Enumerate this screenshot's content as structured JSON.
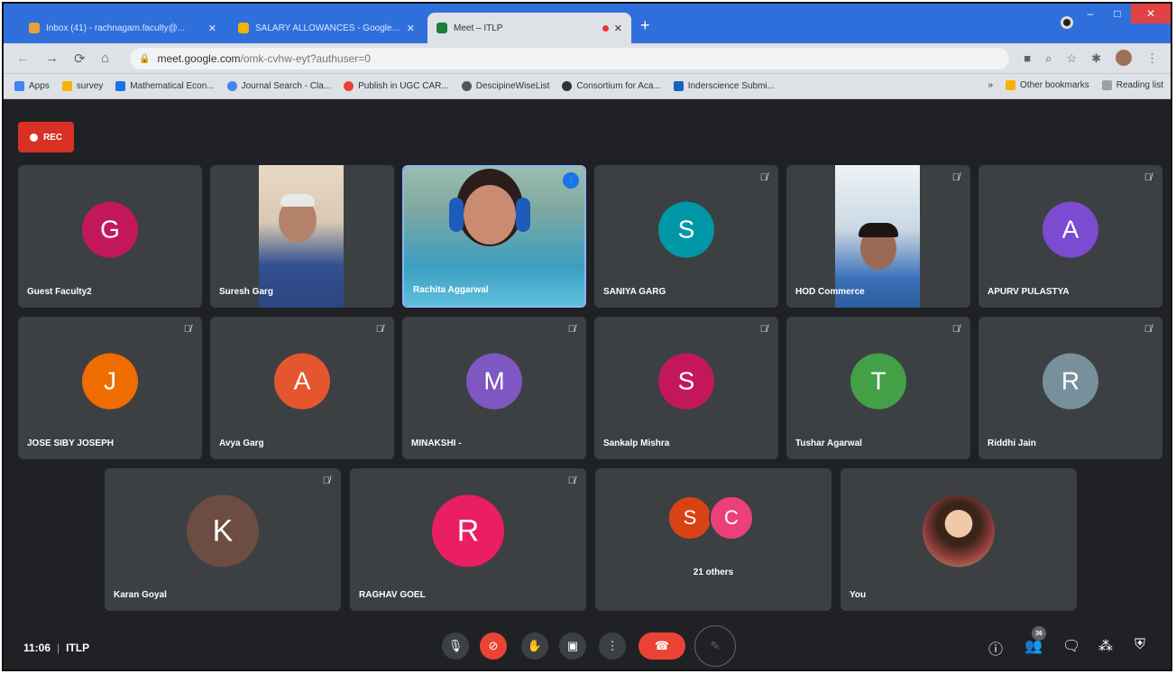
{
  "browser": {
    "tabs": [
      {
        "title": "Inbox (41) - rachnagam.faculty@...",
        "active": false,
        "favicon_color": "#e9a23b"
      },
      {
        "title": "SALARY ALLOWANCES - Google...",
        "active": false,
        "favicon_color": "#f4b400"
      },
      {
        "title": "Meet – ITLP",
        "active": true,
        "favicon_color": "#188038"
      }
    ],
    "new_tab": "+",
    "url_host": "meet.google.com",
    "url_path": "/omk-cvhw-eyt?authuser=0",
    "bookmarks": [
      {
        "label": "Apps",
        "icon_color": "#4285f4"
      },
      {
        "label": "survey",
        "icon_color": "#f4b400"
      },
      {
        "label": "Mathematical Econ...",
        "icon_color": "#1a73e8"
      },
      {
        "label": "Journal Search - Cla...",
        "icon_color": "#4285f4"
      },
      {
        "label": "Publish in UGC CAR...",
        "icon_color": "#ea4335"
      },
      {
        "label": "DescipineWiseList",
        "icon_color": "#555555"
      },
      {
        "label": "Consortium for Aca...",
        "icon_color": "#333333"
      },
      {
        "label": "Inderscience Submi...",
        "icon_color": "#1565c0"
      }
    ],
    "bookmarks_overflow": "»",
    "other_bookmarks": "Other bookmarks",
    "reading_list": "Reading list"
  },
  "meet": {
    "rec_label": "REC",
    "participants": [
      {
        "name": "Guest Faculty2",
        "initial": "G",
        "color": "#c2185b",
        "muted": false
      },
      {
        "name": "Suresh Garg",
        "video": true,
        "muted": false
      },
      {
        "name": "Rachita Aggarwal",
        "video": true,
        "speaking": true
      },
      {
        "name": "SANIYA GARG",
        "initial": "S",
        "color": "#0097a7",
        "muted": true
      },
      {
        "name": "HOD Commerce",
        "video": true,
        "muted": true
      },
      {
        "name": "APURV PULASTYA",
        "initial": "A",
        "color": "#7b4bd1",
        "muted": true
      },
      {
        "name": "JOSE SIBY JOSEPH",
        "initial": "J",
        "color": "#ef6c00",
        "muted": true
      },
      {
        "name": "Avya Garg",
        "initial": "A",
        "color": "#e4572e",
        "muted": true
      },
      {
        "name": "MINAKSHI -",
        "initial": "M",
        "color": "#7e57c2",
        "muted": true
      },
      {
        "name": "Sankalp Mishra",
        "initial": "S",
        "color": "#c2185b",
        "muted": true
      },
      {
        "name": "Tushar Agarwal",
        "initial": "T",
        "color": "#43a047",
        "muted": true
      },
      {
        "name": "Riddhi Jain",
        "initial": "R",
        "color": "#78909c",
        "muted": true
      },
      {
        "name": "Karan Goyal",
        "initial": "K",
        "color": "#6d4c41",
        "muted": true
      },
      {
        "name": "RAGHAV GOEL",
        "initial": "R",
        "color": "#e91e63",
        "muted": true
      }
    ],
    "others": {
      "initials": [
        "S",
        "C"
      ],
      "colors": [
        "#d84315",
        "#ec407a"
      ],
      "label": "21 others"
    },
    "you_label": "You",
    "time": "11:06",
    "meeting_name": "ITLP",
    "people_count": "36",
    "mute_icon": "mic-off-icon"
  }
}
